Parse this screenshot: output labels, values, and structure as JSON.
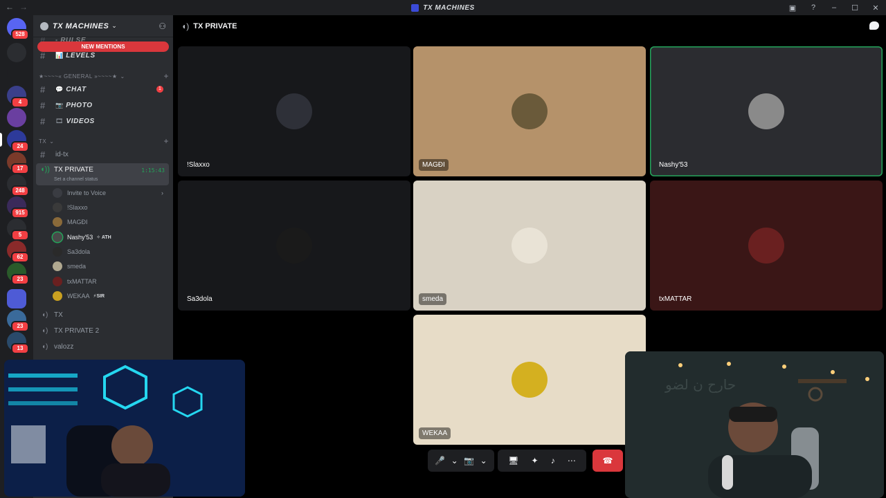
{
  "window": {
    "title": "TX MACHINES",
    "back_icon": "←",
    "forward_icon": "→"
  },
  "rail": {
    "servers": [
      {
        "name": "direct-messages",
        "badge": "528",
        "color": "#5865f2"
      },
      {
        "name": "arc",
        "badge": "",
        "color": "#2b2d31"
      },
      {
        "name": "53",
        "badge": "",
        "color": "#1e1f22"
      },
      {
        "name": "gaming",
        "badge": "4",
        "color": "#3a3f8a"
      },
      {
        "name": "server-5",
        "badge": "",
        "color": "#6a3fa0"
      },
      {
        "name": "tx",
        "badge": "24",
        "color": "#2d3a9a"
      },
      {
        "name": "server-7",
        "badge": "17",
        "color": "#7a3a2a"
      },
      {
        "name": "at",
        "badge": "248",
        "color": "#2b2d31"
      },
      {
        "name": "server-9",
        "badge": "915",
        "color": "#3a2a5a"
      },
      {
        "name": "c-server",
        "badge": "5",
        "color": "#2b2d31"
      },
      {
        "name": "server-11",
        "badge": "62",
        "color": "#8a2a2a"
      },
      {
        "name": "server-12",
        "badge": "23",
        "color": "#2a5a2a"
      },
      {
        "name": "folder",
        "badge": "",
        "color": "#4e5bd6"
      },
      {
        "name": "server-14",
        "badge": "23",
        "color": "#3a6a9a"
      },
      {
        "name": "server-15",
        "badge": "13",
        "color": "#2a4a6a"
      }
    ]
  },
  "guild": {
    "name": "TX MACHINES",
    "new_mentions": "NEW MENTIONS",
    "channels_top": [
      {
        "label": "RULSE",
        "emoji": "▪"
      },
      {
        "label": "LEVELS",
        "emoji": "📊"
      }
    ],
    "category_general": "★~~~~« GENERAL »~~~~★",
    "channels_general": [
      {
        "label": "CHAT",
        "emoji": "💬",
        "badge": "1"
      },
      {
        "label": "PHOTO",
        "emoji": "📷",
        "badge": ""
      },
      {
        "label": "VIDEOS",
        "emoji": "🎞",
        "badge": ""
      }
    ],
    "category_tx": "TX",
    "channel_id": "id-tx",
    "voice_active": {
      "name": "TX PRIVATE",
      "timer": "1:15:43",
      "status": "Set a channel status"
    },
    "invite_label": "Invite to Voice",
    "members": [
      {
        "name": "!Slaxxo",
        "tag": "",
        "color": "#3a3a3a"
      },
      {
        "name": "MAGĐI",
        "tag": "",
        "color": "#8a6a3a"
      },
      {
        "name": "Nashy'53",
        "tag": "ATH",
        "color": "#4a4a4a"
      },
      {
        "name": "Sa3dola",
        "tag": "",
        "color": "#2a2a2a"
      },
      {
        "name": "smeda",
        "tag": "",
        "color": "#b0a890"
      },
      {
        "name": "txMATTAR",
        "tag": "",
        "color": "#6a2020"
      },
      {
        "name": "WEKAA",
        "tag": "SIR",
        "color": "#c9a020"
      }
    ],
    "voice_channels": [
      "TX",
      "TX PRIVATE 2",
      "valozz"
    ]
  },
  "main": {
    "channel_title": "TX PRIVATE",
    "tiles": [
      {
        "name": "!Slaxxo",
        "bg": "#17181b",
        "avatar": "#2e3038",
        "speaking": false,
        "label_bg": "transparent"
      },
      {
        "name": "MAGĐI",
        "bg": "#b5926a",
        "avatar": "#6a5a3a",
        "speaking": false,
        "label_bg": "rgba(0,0,0,0.45)"
      },
      {
        "name": "Nashy'53",
        "bg": "#2b2c30",
        "avatar": "#8a8a8a",
        "speaking": true,
        "label_bg": "transparent"
      },
      {
        "name": "Sa3dola",
        "bg": "#17181b",
        "avatar": "#1a1a1a",
        "speaking": false,
        "label_bg": "transparent"
      },
      {
        "name": "smeda",
        "bg": "#d9d2c4",
        "avatar": "#e9e3d6",
        "speaking": false,
        "label_bg": "rgba(0,0,0,0.45)"
      },
      {
        "name": "txMATTAR",
        "bg": "#3a1616",
        "avatar": "#6a2020",
        "speaking": false,
        "label_bg": "transparent"
      },
      {
        "name": "WEKAA",
        "bg": "#e7dcc7",
        "avatar": "#d4b020",
        "speaking": false,
        "label_bg": "rgba(0,0,0,0.45)"
      }
    ],
    "controls": {
      "mic_icon": "🎤",
      "camera_icon": "📷",
      "screen_share_icon": "🖥",
      "activities_icon": "✦",
      "soundboard_icon": "♪",
      "more_icon": "⋯",
      "disconnect_icon": "☎",
      "chevron": "⌄"
    }
  }
}
